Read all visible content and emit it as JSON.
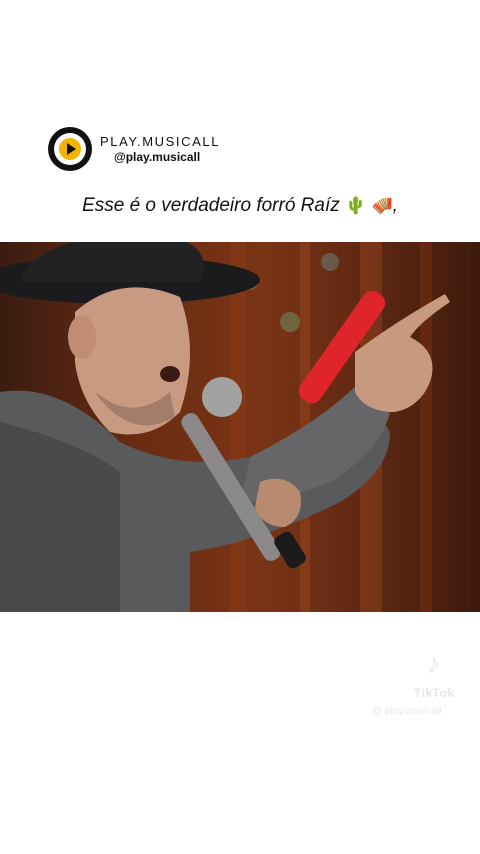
{
  "header": {
    "brand_name": "PLAY.MUSICALL",
    "handle": "@play.musicall",
    "logo_icon": "play-circle-logo",
    "accent_color": "#f5b400"
  },
  "caption": {
    "text": "Esse é o verdadeiro forró Raíz",
    "emoji_1": "🌵",
    "emoji_2": "🪗",
    "trailing": ","
  },
  "video": {
    "content": "singer-performing-with-microphone"
  },
  "watermark": {
    "logo_icon": "tiktok-note-icon",
    "logo_glyph": "♪",
    "word": "TikTok",
    "handle": "@ play.musicall"
  }
}
